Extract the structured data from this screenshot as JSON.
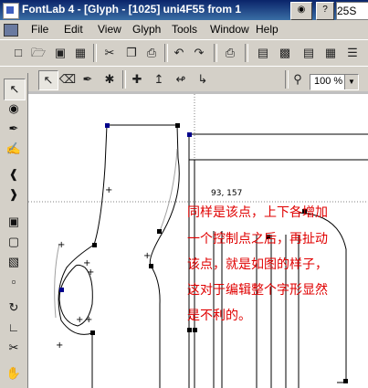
{
  "window": {
    "title": "FontLab 4 - [Glyph - [1025] uni4F55 from 1",
    "right_fragment": "25S"
  },
  "menu": [
    "File",
    "Edit",
    "View",
    "Glyph",
    "Tools",
    "Window",
    "Help"
  ],
  "zoom": {
    "value": "100 %"
  },
  "canvas": {
    "coord_readout": "93, 157",
    "annotation_lines": [
      "同样是该点，上下各增加",
      "一个控制点之后，再扯动",
      "该点，就是如图的样子，",
      "这对于编辑整个字形显然",
      "是不利的。"
    ],
    "annotation_color": "#e00000",
    "node_color": "#000000",
    "selected_node_color": "#00008b",
    "guide_color": "#808080"
  },
  "icons": {
    "main_toolbar": [
      "new-icon",
      "open-icon",
      "save-icon",
      "save-all-icon",
      "cut-icon",
      "copy-icon",
      "paste-icon",
      "undo-icon",
      "redo-icon",
      "print-icon",
      "metrics-icon",
      "kerning-icon",
      "font-info-icon",
      "panel-icon",
      "list-icon"
    ],
    "edit_toolbar": [
      "pointer-icon",
      "eraser-icon",
      "pen-icon",
      "magic-wand-icon",
      "add-node-icon",
      "tangent-node-icon",
      "smooth-node-icon",
      "corner-node-icon",
      "zoom-icon"
    ],
    "left_tools": [
      "arrow-icon",
      "contour-icon",
      "brush-icon",
      "ruler-icon",
      "left-arrow-icon",
      "right-arrow-icon",
      "node-select-icon",
      "transform-icon",
      "blend-icon",
      "skew-icon",
      "rotate-icon",
      "measure-icon",
      "knife-icon",
      "hand-icon"
    ]
  }
}
